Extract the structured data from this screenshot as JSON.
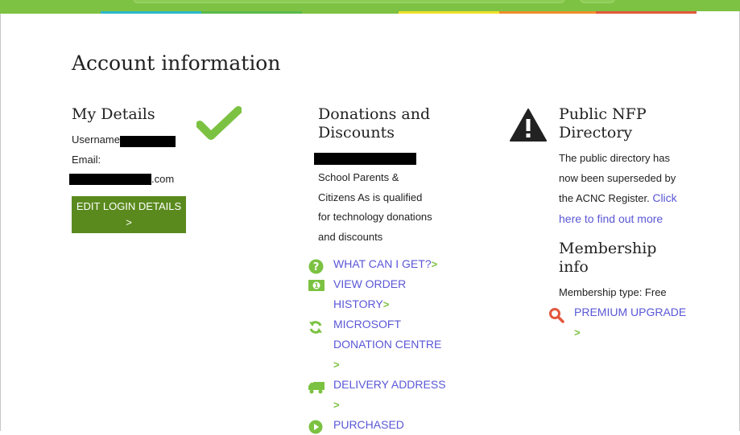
{
  "colors": {
    "header_green": "#7dc242",
    "link_blue": "#5a57d6",
    "button_green": "#5a8a1e",
    "icon_green": "#7cc242",
    "stripes": [
      "#7dc242",
      "#2bb7c9",
      "#59b94c",
      "#7dc242",
      "#f0e12b",
      "#f28c2b",
      "#e3573b"
    ]
  },
  "page": {
    "title": "Account information"
  },
  "my_details": {
    "title": "My Details",
    "username_label": "Username:",
    "email_label": "Email:",
    "email_suffix": ".com",
    "edit_button_line1": "EDIT LOGIN DETAILS",
    "edit_button_line2": ">",
    "status_icon": "check-icon"
  },
  "donations": {
    "title_line1": "Donations and",
    "title_line2": "Discounts",
    "desc_lines": [
      "School Parents &",
      "Citizens As is qualified",
      "for technology donations",
      "and discounts"
    ],
    "menu": [
      {
        "icon": "question-circle-icon",
        "lines": [
          "WHAT CAN I GET?"
        ],
        "chevron": ">"
      },
      {
        "icon": "money-icon",
        "lines": [
          "VIEW ORDER",
          "HISTORY"
        ],
        "chevron": ">"
      },
      {
        "icon": "refresh-icon",
        "lines": [
          "MICROSOFT",
          "DONATION CENTRE"
        ],
        "chevron": ">"
      },
      {
        "icon": "truck-icon",
        "lines": [
          "DELIVERY ADDRESS"
        ],
        "chevron": ">"
      },
      {
        "icon": "play-circle-icon",
        "lines": [
          "PURCHASED"
        ],
        "chevron": ""
      }
    ]
  },
  "directory": {
    "title_line1": "Public NFP",
    "title_line2": "Directory",
    "warning_icon": "warning-icon",
    "desc_lines": [
      "The public directory has",
      "now been superseded by"
    ],
    "desc_line3_text": "the ACNC Register. ",
    "desc_line3_link": "Click",
    "desc_line4_link": "here to find out more"
  },
  "membership": {
    "title_line1": "Membership",
    "title_line2": "info",
    "type_text": "Membership type: Free",
    "upgrade_label": "PREMIUM UPGRADE",
    "upgrade_chevron": ">",
    "upgrade_icon": "search-icon"
  }
}
